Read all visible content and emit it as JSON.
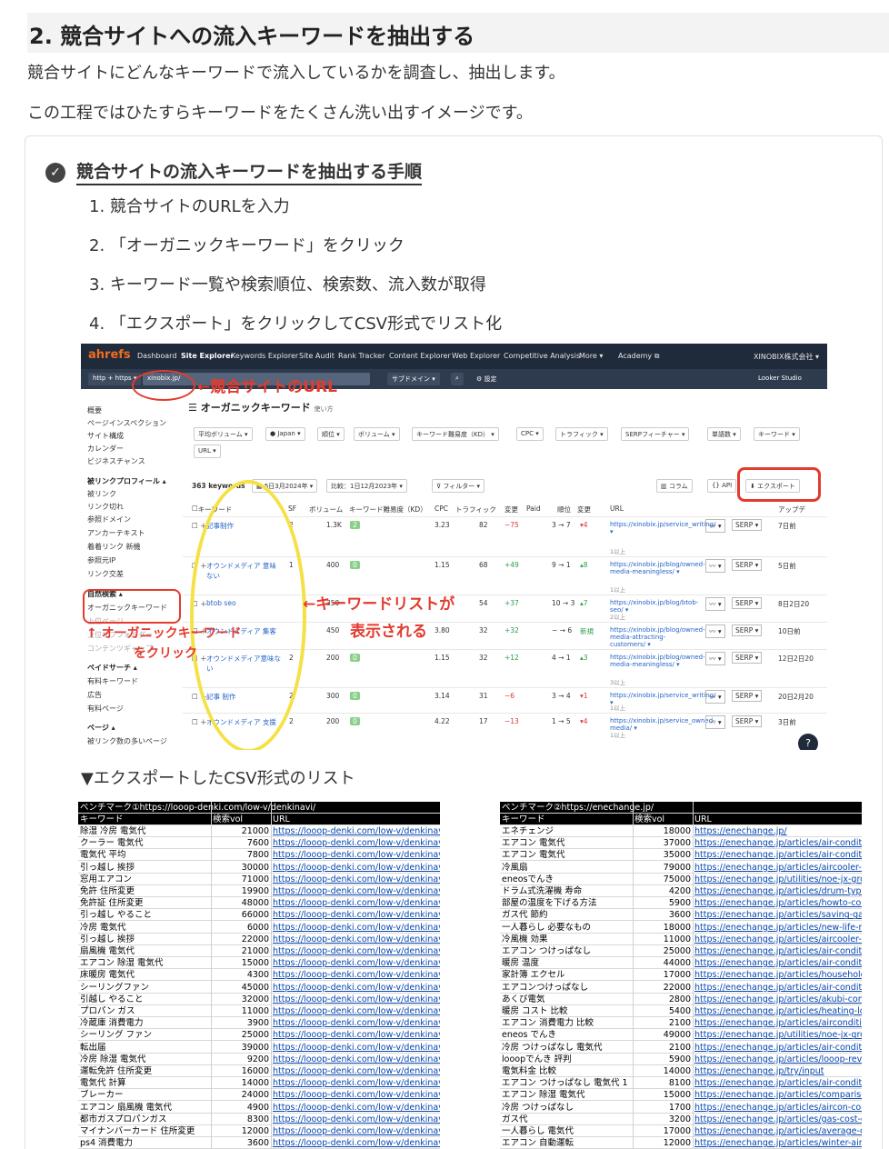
{
  "section_title": "2. 競合サイトへの流入キーワードを抽出する",
  "intro": [
    "競合サイトにどんなキーワードで流入しているかを調査し、抽出します。",
    "この工程ではひたすらキーワードをたくさん洗い出すイメージです。"
  ],
  "procedure": {
    "title": "競合サイトの流入キーワードを抽出する手順",
    "check_icon": "check-circle-icon",
    "steps": [
      "1.  競合サイトのURLを入力",
      "2.  「オーガニックキーワード」をクリック",
      "3.  キーワード一覧や検索順位、検索数、流入数が取得",
      "4.  「エクスポート」をクリックしてCSV形式でリスト化"
    ]
  },
  "screenshot": {
    "logo_a": "ahrefs",
    "nav": [
      "Dashboard",
      "Site Explorer",
      "Keywords Explorer",
      "Site Audit",
      "Rank Tracker",
      "Content Explorer",
      "Web Explorer",
      "Competitive Analysis",
      "More ▾",
      "Academy ⧉"
    ],
    "account": "XINOBIX株式会社 ▾",
    "looker": "Looker Studio",
    "protocol": "http + https ▾",
    "domain_input": "xinobix.jp/",
    "subdomain": "サブドメイン ▾",
    "settings": "設定",
    "page_title": "オーガニックキーワード",
    "usage": "使い方",
    "sidebar": [
      {
        "t": "概要",
        "hd": false
      },
      {
        "t": "ページインスペクション",
        "hd": false
      },
      {
        "t": "サイト構成",
        "hd": false
      },
      {
        "t": "カレンダー",
        "hd": false
      },
      {
        "t": "ビジネスチャンス",
        "hd": false
      },
      {
        "t": "被リンクプロフィール ▴",
        "hd": true
      },
      {
        "t": "被リンク",
        "hd": false
      },
      {
        "t": "リンク切れ",
        "hd": false
      },
      {
        "t": "参照ドメイン",
        "hd": false
      },
      {
        "t": "アンカーテキスト",
        "hd": false
      },
      {
        "t": "着着リンク 新機",
        "hd": false
      },
      {
        "t": "参照元IP",
        "hd": false
      },
      {
        "t": "リンク交差",
        "hd": false
      },
      {
        "t": "自然検索 ▴",
        "hd": true
      },
      {
        "t": "オーガニックキーワード",
        "hd": false
      },
      {
        "t": "上位ページ",
        "hd": false
      },
      {
        "t": "上位サブフォルダー",
        "hd": false
      },
      {
        "t": "コンテンツギャップ",
        "hd": false
      },
      {
        "t": "ペイドサーチ ▴",
        "hd": true
      },
      {
        "t": "有料キーワード",
        "hd": false
      },
      {
        "t": "広告",
        "hd": false
      },
      {
        "t": "有料ページ",
        "hd": false
      },
      {
        "t": "ページ ▴",
        "hd": true
      },
      {
        "t": "被リンク数の多いページ",
        "hd": false
      }
    ],
    "filters": [
      "平均ボリューム ▾",
      "● Japan ▾",
      "順位 ▾",
      "ボリューム ▾",
      "キーワード難易度（KD） ▾",
      "CPC ▾",
      "トラフィック ▾",
      "SERPフィーチャー ▾",
      "単語数 ▾",
      "キーワード ▾",
      "URL ▾"
    ],
    "count": "363 keywords",
    "date": "5日3月2024年 ▾",
    "compare": "比較：1日12月2023年 ▾",
    "filter_btn": "フィルター ▾",
    "columns_btn": "コラム",
    "api_btn": "API",
    "export_btn": "エクスポート",
    "headers": [
      "キーワード",
      "SF",
      "ボリューム",
      "キーワード難易度（KD）",
      "CPC",
      "トラフィック",
      "変更",
      "Paid",
      "順位",
      "変更",
      "URL",
      "",
      "",
      "アップデ"
    ],
    "rows": [
      {
        "kw": "記事制作",
        "sf": "2",
        "vol": "1.3K",
        "kd": "2",
        "cpc": "3.23",
        "tr": "82",
        "ch": "−75",
        "chc": "red",
        "pos": "3 → 7",
        "pc": "▾4",
        "pcc": "red",
        "url": "https://xinobix.jp/service_writing/ ▾",
        "url2": "1以上",
        "upd": "7日前"
      },
      {
        "kw": "オウンドメディア 意味ない",
        "sf": "1",
        "vol": "400",
        "kd": "0",
        "cpc": "1.15",
        "tr": "68",
        "ch": "+49",
        "chc": "grn",
        "pos": "9 → 1",
        "pc": "▴8",
        "pcc": "grn",
        "url": "https://xinobix.jp/blog/owned-media-meaningless/ ▾",
        "url2": "1以上",
        "upd": "5日前"
      },
      {
        "kw": "btob seo",
        "sf": "",
        "vol": "350",
        "kd": "",
        "cpc": "",
        "tr": "54",
        "ch": "+37",
        "chc": "grn",
        "pos": "10 → 3",
        "pc": "▴7",
        "pcc": "grn",
        "url": "https://xinobix.jp/blog/btob-seo/ ▾",
        "url2": "2以上",
        "upd": "8日2日20"
      },
      {
        "kw": "オウンドメディア 集客",
        "sf": "",
        "vol": "450",
        "kd": "",
        "cpc": "3.80",
        "tr": "32",
        "ch": "+32",
        "chc": "grn",
        "pos": "− → 6",
        "pc": "新規",
        "pcc": "grn",
        "url": "https://xinobix.jp/blog/owned-media-attracting-customers/ ▾",
        "url2": "",
        "upd": "10日前"
      },
      {
        "kw": "オウンドメディア意味ない",
        "sf": "2",
        "vol": "200",
        "kd": "0",
        "cpc": "1.15",
        "tr": "32",
        "ch": "+12",
        "chc": "grn",
        "pos": "4 → 1",
        "pc": "▴3",
        "pcc": "grn",
        "url": "https://xinobix.jp/blog/owned-media-meaningless/ ▾",
        "url2": "3以上",
        "upd": "12日2日20"
      },
      {
        "kw": "記事 制作",
        "sf": "2",
        "vol": "300",
        "kd": "0",
        "cpc": "3.14",
        "tr": "31",
        "ch": "−6",
        "chc": "red",
        "pos": "3 → 4",
        "pc": "▾1",
        "pcc": "red",
        "url": "https://xinobix.jp/service_writing/ ▾",
        "url2": "1以上",
        "upd": "20日2月20"
      },
      {
        "kw": "オウンドメディア 支援",
        "sf": "2",
        "vol": "200",
        "kd": "0",
        "cpc": "4.22",
        "tr": "17",
        "ch": "−13",
        "chc": "red",
        "pos": "1 → 5",
        "pc": "▾4",
        "pcc": "red",
        "url": "https://xinobix.jp/service_owned-media/ ▾",
        "url2": "1以上",
        "upd": "3日前"
      }
    ],
    "annot_url": "←競合サイトのURL",
    "annot_list_1": "←キーワードリストが",
    "annot_list_2": "表示される",
    "annot_organic_1": "↑ オーガニックキーワード",
    "annot_organic_2": "をクリック"
  },
  "csv": {
    "heading": "▼エクスポートしたCSV形式のリスト",
    "left": {
      "title": "ベンチマーク①https://looop-denki.com/low-v/denkinavi/",
      "cols": [
        "キーワード",
        "検索vol",
        "URL"
      ],
      "rows": [
        [
          "除湿 冷房 電気代",
          "21000",
          "https://looop-denki.com/low-v/denkinavi/acd"
        ],
        [
          "クーラー 電気代",
          "7600",
          "https://looop-denki.com/low-v/denkinavi/airc"
        ],
        [
          "電気代 平均",
          "7800",
          "https://looop-denki.com/low-v/denkinavi/ave"
        ],
        [
          "引っ越し 挨拶",
          "30000",
          "https://looop-denki.com/low-v/denkinavi/mo"
        ],
        [
          "窓用エアコン",
          "71000",
          "https://looop-denki.com/low-v/denkinavi/win"
        ],
        [
          "免許 住所変更",
          "19900",
          "https://looop-denki.com/low-v/denkinavi/mo"
        ],
        [
          "免許証 住所変更",
          "48000",
          "https://looop-denki.com/low-v/denkinavi/mo"
        ],
        [
          "引っ越し やること",
          "66000",
          "https://looop-denki.com/low-v/denkinavi/mo"
        ],
        [
          "冷房 電気代",
          "6000",
          "https://looop-denki.com/low-v/denkinavi/airc"
        ],
        [
          "引っ越し 挨拶",
          "22000",
          "https://looop-denki.com/low-v/denkinavi/mo"
        ],
        [
          "扇風機 電気代",
          "21000",
          "https://looop-denki.com/low-v/denkinavi/ele"
        ],
        [
          "エアコン 除湿 電気代",
          "15000",
          "https://looop-denki.com/low-v/denkinavi/acd"
        ],
        [
          "床暖房 電気代",
          "4300",
          "https://looop-denki.com/low-v/denkinavi/floo"
        ],
        [
          "シーリングファン",
          "45000",
          "https://looop-denki.com/low-v/denkinavi/ceil"
        ],
        [
          "引越し やること",
          "32000",
          "https://looop-denki.com/low-v/denkinavi/mo"
        ],
        [
          "プロパン ガス",
          "11000",
          "https://looop-denki.com/low-v/denkinavi/city"
        ],
        [
          "冷蔵庫 消費電力",
          "3900",
          "https://looop-denki.com/low-v/denkinavi/refr"
        ],
        [
          "シーリング ファン",
          "25000",
          "https://looop-denki.com/low-v/denkinavi/ceil"
        ],
        [
          "転出届",
          "39000",
          "https://looop-denki.com/low-v/denkinavi/mo"
        ],
        [
          "冷房 除湿 電気代",
          "9200",
          "https://looop-denki.com/low-v/denkinavi/acd"
        ],
        [
          "運転免許 住所変更",
          "16000",
          "https://looop-denki.com/low-v/denkinavi/mo"
        ],
        [
          "電気代 計算",
          "14000",
          "https://looop-denki.com/low-v/denkinavi/ele"
        ],
        [
          "ブレーカー",
          "24000",
          "https://looop-denki.com/low-v/denkinavi/bre"
        ],
        [
          "エアコン 扇風機 電気代",
          "4900",
          "https://looop-denki.com/low-v/denkinavi/ele"
        ],
        [
          "都市ガスプロパンガス",
          "8300",
          "https://looop-denki.com/low-v/denkinavi/city"
        ],
        [
          "マイナンバーカード 住所変更",
          "12000",
          "https://looop-denki.com/low-v/denkinavi/mo"
        ],
        [
          "ps4 消費電力",
          "3600",
          "https://looop-denki.com/low-v/denkinavi/gan"
        ]
      ]
    },
    "right": {
      "title": "ベンチマーク②https://enechange.jp/",
      "cols": [
        "キーワード",
        "検索vol",
        "URL"
      ],
      "rows": [
        [
          "エネチェンジ",
          "18000",
          "https://enechange.jp/"
        ],
        [
          "エアコン 電気代",
          "37000",
          "https://enechange.jp/articles/air-conditioner-"
        ],
        [
          "エアコン 電気代",
          "35000",
          "https://enechange.jp/articles/air-conditioner-"
        ],
        [
          "冷風扇",
          "79000",
          "https://enechange.jp/articles/aircooler-cost"
        ],
        [
          "eneosでんき",
          "75000",
          "https://enechange.jp/utilities/noe-jx-group"
        ],
        [
          "ドラム式洗濯機 寿命",
          "4200",
          "https://enechange.jp/articles/drum-type-was"
        ],
        [
          "部屋の温度を下げる方法",
          "5900",
          "https://enechange.jp/articles/howto-coolther"
        ],
        [
          "ガス代 節約",
          "3600",
          "https://enechange.jp/articles/saving-gas-cos"
        ],
        [
          "一人暮らし 必要なもの",
          "18000",
          "https://enechange.jp/articles/new-life-musth"
        ],
        [
          "冷風機 効果",
          "11000",
          "https://enechange.jp/articles/aircooler-cost"
        ],
        [
          "エアコン つけっぱなし",
          "25000",
          "https://enechange.jp/articles/air-conditioner-"
        ],
        [
          "暖房 温度",
          "44000",
          "https://enechange.jp/articles/air-conditioner-"
        ],
        [
          "家計簿 エクセル",
          "17000",
          "https://enechange.jp/articles/household-acc"
        ],
        [
          "エアコンつけっぱなし",
          "22000",
          "https://enechange.jp/articles/air-conditioner-"
        ],
        [
          "あくび電気",
          "2800",
          "https://enechange.jp/articles/akubi-commun"
        ],
        [
          "暖房 コスト 比較",
          "5400",
          "https://enechange.jp/articles/heating-low-co"
        ],
        [
          "エアコン 消費電力 比較",
          "2100",
          "https://enechange.jp/articles/airconditioner-"
        ],
        [
          "eneos でんき",
          "49000",
          "https://enechange.jp/utilities/noe-jx-group"
        ],
        [
          "冷房 つけっぱなし 電気代",
          "2100",
          "https://enechange.jp/articles/air-conditioner-"
        ],
        [
          "looopでんき 評判",
          "5900",
          "https://enechange.jp/articles/looop-review"
        ],
        [
          "電気料金 比較",
          "14000",
          "https://enechange.jp/try/input"
        ],
        [
          "エアコン つけっぱなし 電気代 1",
          "8100",
          "https://enechange.jp/articles/air-conditioner-"
        ],
        [
          "エアコン 除湿 電気代",
          "15000",
          "https://enechange.jp/articles/comparison-co"
        ],
        [
          "冷房 つけっぱなし",
          "1700",
          "https://enechange.jp/articles/aircon-cooling"
        ],
        [
          "ガス代",
          "3200",
          "https://enechange.jp/articles/gas-cost-exper"
        ],
        [
          "一人暮らし 電気代",
          "17000",
          "https://enechange.jp/articles/average-of-sin"
        ],
        [
          "エアコン 自動運転",
          "12000",
          "https://enechange.jp/articles/winter-air-cond"
        ]
      ]
    }
  },
  "colors": {
    "annot_red": "#e33b2e",
    "highlight_yellow": "#f5e146",
    "heading_bg": "#f3f3f3",
    "topbar": "#1f2a3a"
  }
}
